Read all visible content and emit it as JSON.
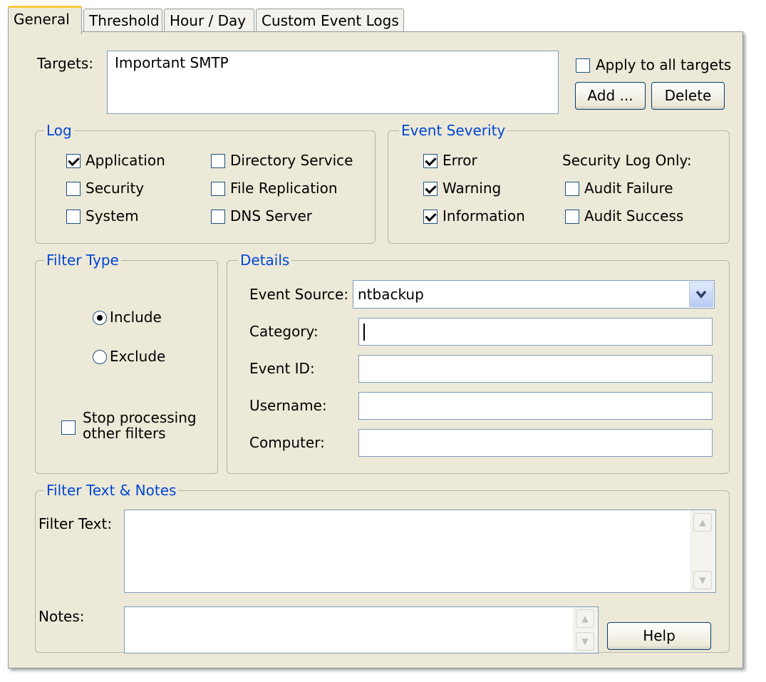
{
  "tabs": [
    {
      "label": "General",
      "active": true
    },
    {
      "label": "Threshold",
      "active": false
    },
    {
      "label": "Hour / Day",
      "active": false
    },
    {
      "label": "Custom Event Logs",
      "active": false
    }
  ],
  "targets": {
    "label": "Targets:",
    "items": [
      "Important SMTP"
    ],
    "apply_all_label": "Apply to all targets",
    "apply_all_checked": false,
    "add_label": "Add ...",
    "delete_label": "Delete"
  },
  "log": {
    "legend": "Log",
    "items": [
      {
        "label": "Application",
        "checked": true
      },
      {
        "label": "Security",
        "checked": false
      },
      {
        "label": "System",
        "checked": false
      },
      {
        "label": "Directory Service",
        "checked": false
      },
      {
        "label": "File Replication",
        "checked": false
      },
      {
        "label": "DNS Server",
        "checked": false
      }
    ]
  },
  "severity": {
    "legend": "Event Severity",
    "items": [
      {
        "label": "Error",
        "checked": true
      },
      {
        "label": "Warning",
        "checked": true
      },
      {
        "label": "Information",
        "checked": true
      }
    ],
    "security_only_label": "Security Log Only:",
    "security_items": [
      {
        "label": "Audit Failure",
        "checked": false
      },
      {
        "label": "Audit Success",
        "checked": false
      }
    ]
  },
  "filter_type": {
    "legend": "Filter Type",
    "include_label": "Include",
    "exclude_label": "Exclude",
    "selected": "Include",
    "stop_processing_line1": "Stop processing",
    "stop_processing_line2": "other filters",
    "stop_processing_checked": false
  },
  "details": {
    "legend": "Details",
    "event_source_label": "Event Source:",
    "event_source_value": "ntbackup",
    "category_label": "Category:",
    "category_value": "",
    "event_id_label": "Event ID:",
    "event_id_value": "",
    "username_label": "Username:",
    "username_value": "",
    "computer_label": "Computer:",
    "computer_value": ""
  },
  "notes_group": {
    "legend": "Filter Text & Notes",
    "filter_text_label": "Filter Text:",
    "filter_text_value": "",
    "notes_label": "Notes:",
    "notes_value": "",
    "help_label": "Help"
  },
  "icons": {
    "scroll_up": "up-arrow",
    "scroll_down": "down-arrow",
    "dropdown": "chevron-down"
  }
}
